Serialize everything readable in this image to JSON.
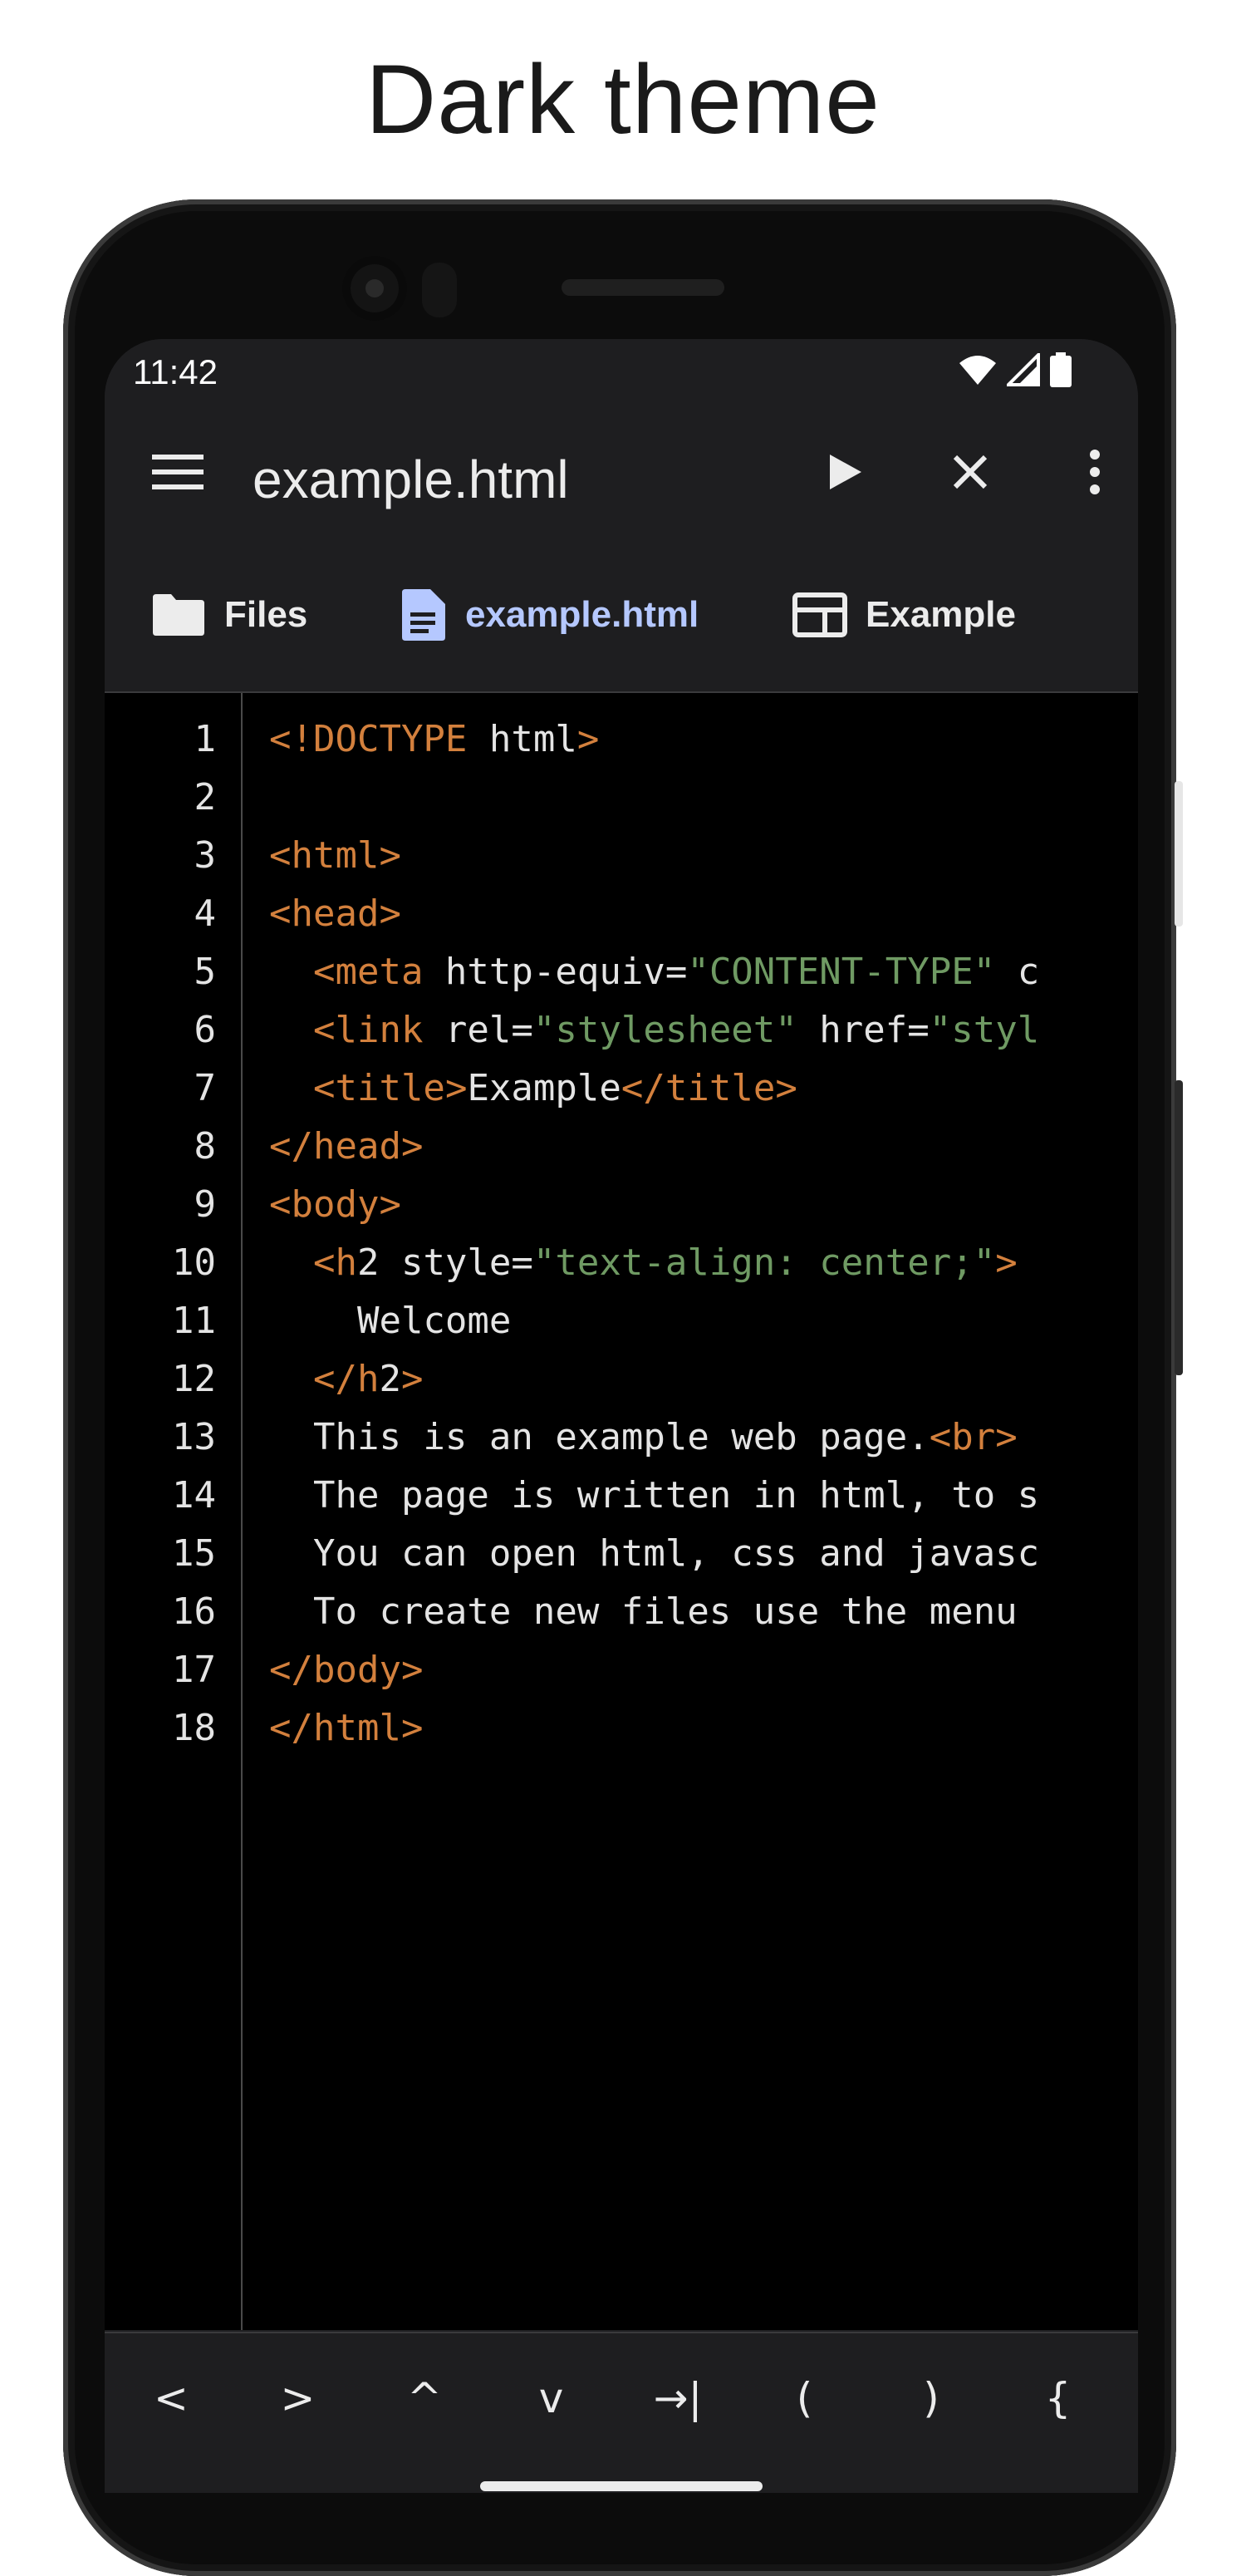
{
  "headline": "Dark theme",
  "status_bar": {
    "time": "11:42"
  },
  "app_bar": {
    "title": "example.html"
  },
  "tabs": [
    {
      "label": "Files",
      "icon": "folder-icon"
    },
    {
      "label": "example.html",
      "icon": "document-icon",
      "active": true
    },
    {
      "label": "Example",
      "icon": "preview-icon"
    }
  ],
  "editor": {
    "lines": [
      {
        "n": "1",
        "code": "<!DOCTYPE html>"
      },
      {
        "n": "2",
        "code": ""
      },
      {
        "n": "3",
        "code": "<html>"
      },
      {
        "n": "4",
        "code": "<head>"
      },
      {
        "n": "5",
        "code": "  <meta http-equiv=\"CONTENT-TYPE\" c"
      },
      {
        "n": "6",
        "code": "  <link rel=\"stylesheet\" href=\"styl"
      },
      {
        "n": "7",
        "code": "  <title>Example</title>"
      },
      {
        "n": "8",
        "code": "</head>"
      },
      {
        "n": "9",
        "code": "<body>"
      },
      {
        "n": "10",
        "code": "  <h2 style=\"text-align: center;\">"
      },
      {
        "n": "11",
        "code": "    Welcome"
      },
      {
        "n": "12",
        "code": "  </h2>"
      },
      {
        "n": "13",
        "code": "  This is an example web page.<br>"
      },
      {
        "n": "14",
        "code": "  The page is written in html, to s"
      },
      {
        "n": "15",
        "code": "  You can open html, css and javasc"
      },
      {
        "n": "16",
        "code": "  To create new files use the menu"
      },
      {
        "n": "17",
        "code": "</body>"
      },
      {
        "n": "18",
        "code": "</html>"
      }
    ]
  },
  "keys": [
    "<",
    ">",
    "^",
    "v",
    "→|",
    "(",
    ")",
    "{"
  ],
  "colors": {
    "tag": "#d3803d",
    "string": "#6f9a63",
    "text": "#e4e4e4",
    "accent": "#b5c8ff"
  }
}
